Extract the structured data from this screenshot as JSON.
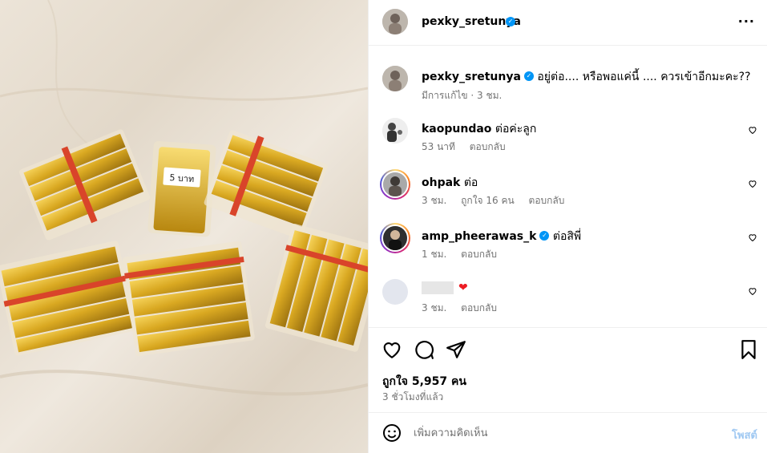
{
  "post": {
    "username": "pexky_sretunya",
    "caption": "อยู่ต่อ.... หรือพอแค่นี้ .... ควรเข้าอีกมะคะ??",
    "caption_meta": "มีการแก้ไข · 3 ชม.",
    "photo_label": "5 บาท"
  },
  "comments": [
    {
      "username": "kaopundao",
      "text": "ต่อค่ะลูก",
      "time": "53 นาที",
      "likes": "",
      "reply": "ตอบกลับ"
    },
    {
      "username": "ohpak",
      "text": "ต่อ",
      "time": "3 ชม.",
      "likes": "ถูกใจ 16 คน",
      "reply": "ตอบกลับ"
    },
    {
      "username": "amp_pheerawas_k",
      "text": "ต่อสิพี่",
      "time": "1 ชม.",
      "likes": "",
      "reply": "ตอบกลับ"
    },
    {
      "username": "",
      "text": "❤",
      "time": "3 ชม.",
      "likes": "",
      "reply": "ตอบกลับ"
    }
  ],
  "actions": {
    "like_count": "ถูกใจ 5,957 คน",
    "posted_ago": "3 ชั่วโมงที่แล้ว"
  },
  "add_comment": {
    "placeholder": "เพิ่มความคิดเห็น",
    "post_label": "โพสต์"
  },
  "colors": {
    "verified": "#0095f6",
    "post_button_disabled": "#9fc8f2",
    "heart_emoji": "#ed1c24"
  }
}
